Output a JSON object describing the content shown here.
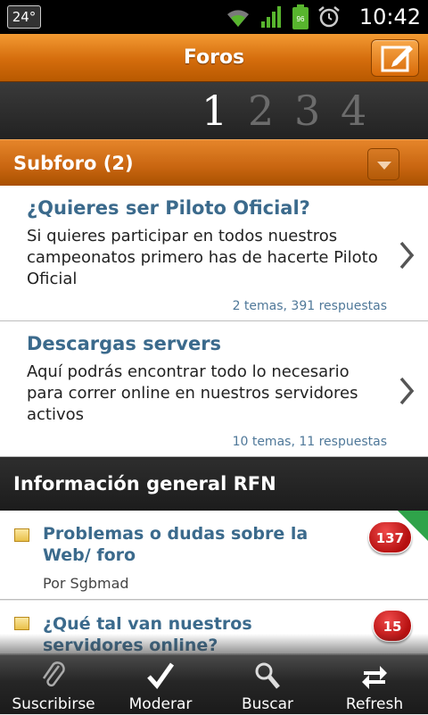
{
  "status_bar": {
    "temperature": "24°",
    "battery_level": "96",
    "time": "10:42"
  },
  "header": {
    "title": "Foros"
  },
  "pager": {
    "pages": [
      "1",
      "2",
      "3",
      "4"
    ],
    "active": "1"
  },
  "subforum_section": {
    "title": "Subforo (2)"
  },
  "subforums": [
    {
      "title": "¿Quieres ser Piloto Oficial?",
      "description": "Si quieres participar en todos nuestros campeonatos primero has de hacerte Piloto Oficial",
      "meta": "2 temas, 391 respuestas"
    },
    {
      "title": "Descargas servers",
      "description": "Aquí podrás encontrar todo lo necesario para correr online en nuestros servidores activos",
      "meta": "10 temas, 11 respuestas"
    }
  ],
  "general_section": {
    "title": "Información general RFN"
  },
  "topics": [
    {
      "title": "Problemas o dudas sobre la Web/ foro",
      "author": "Por Sgbmad",
      "replies": "137"
    },
    {
      "title": "¿Qué tal van nuestros servidores online?",
      "author": "",
      "replies": "15"
    }
  ],
  "toolbar": {
    "subscribe": "Suscribirse",
    "moderate": "Moderar",
    "search": "Buscar",
    "refresh": "Refresh"
  },
  "colors": {
    "accent_orange": "#d46c0c",
    "link_blue": "#3b6a8c",
    "badge_red": "#c81414"
  }
}
